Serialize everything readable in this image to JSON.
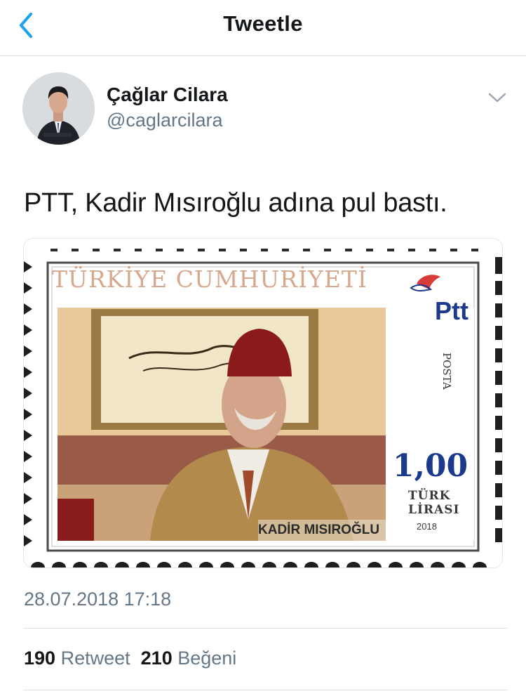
{
  "header": {
    "title": "Tweetle",
    "back_icon": "chevron-left-icon"
  },
  "author": {
    "name": "Çağlar Cilara",
    "handle": "@caglarcilara"
  },
  "tweet": {
    "text": "PTT, Kadir Mısıroğlu adına pul bastı."
  },
  "stamp": {
    "country": "TÜRKİYE CUMHURİYETİ",
    "brand": "Ptt",
    "posta": "POSTA",
    "value": "1,00",
    "currency_line1": "TÜRK",
    "currency_line2": "LİRASI",
    "year": "2018",
    "caption": "KADİR MISIROĞLU"
  },
  "meta": {
    "timestamp": "28.07.2018 17:18"
  },
  "stats": {
    "retweets": "190",
    "retweets_label": "Retweet",
    "likes": "210",
    "likes_label": "Beğeni"
  },
  "colors": {
    "accent": "#1da1f2",
    "secondary_text": "#657786",
    "stamp_title": "#d6a98e",
    "stamp_blue": "#1b3a8c"
  }
}
